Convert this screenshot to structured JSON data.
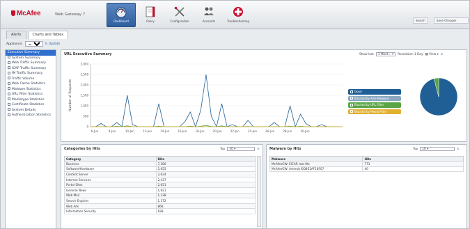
{
  "header": {
    "logo_text": "McAfee",
    "product_name": "Web Gateway 7",
    "nav": [
      {
        "label": "Dashboard",
        "icon": "dashboard-icon",
        "active": true
      },
      {
        "label": "Policy",
        "icon": "policy-icon",
        "active": false
      },
      {
        "label": "Configuration",
        "icon": "configuration-icon",
        "active": false
      },
      {
        "label": "Accounts",
        "icon": "accounts-icon",
        "active": false
      },
      {
        "label": "Troubleshooting",
        "icon": "troubleshooting-icon",
        "active": false
      }
    ],
    "search_label": "Search",
    "save_label": "Save Changes"
  },
  "tabs": [
    {
      "label": "Alerts",
      "active": false
    },
    {
      "label": "Charts and Tables",
      "active": true
    }
  ],
  "toolbar": {
    "appliance_label": "Appliance:",
    "appliance_value": "mwg7...",
    "update_label": "Update"
  },
  "sidebar": {
    "items": [
      {
        "label": "Executive Summary",
        "selected": true
      },
      {
        "label": "System Summary",
        "selected": false
      },
      {
        "label": "Web Traffic Summary",
        "selected": false
      },
      {
        "label": "ICAP Traffic Summary",
        "selected": false
      },
      {
        "label": "IM Traffic Summary",
        "selected": false
      },
      {
        "label": "Traffic Volume",
        "selected": false
      },
      {
        "label": "Web Cache Statistics",
        "selected": false
      },
      {
        "label": "Malware Statistics",
        "selected": false
      },
      {
        "label": "URL Filter Statistics",
        "selected": false
      },
      {
        "label": "Mediatype Statistics",
        "selected": false
      },
      {
        "label": "Certificate Statistics",
        "selected": false
      },
      {
        "label": "System Details",
        "selected": false
      },
      {
        "label": "Authentication Statistics",
        "selected": false
      }
    ]
  },
  "url_summary": {
    "title": "URL Executive Summary",
    "show_last_label": "Show last",
    "show_last_value": "1 Mont...",
    "resolution_label": "Resolution 1 Day",
    "view_label": "View"
  },
  "chart_data": {
    "type": "line",
    "ylabel": "Number of Requests",
    "ylim": [
      0,
      3000
    ],
    "yticks": [
      "3,000",
      "2,500",
      "2,000",
      "1,500",
      "1,000",
      "500",
      "0"
    ],
    "xticks": [
      "6-Jun",
      "8-Jun",
      "10-Jun",
      "12-Jun",
      "14-Jun",
      "16-Jun",
      "18-Jun",
      "20-Jun",
      "22-Jun",
      "24-Jun",
      "26-Jun",
      "28-Jun",
      "30-Jun"
    ],
    "x": [
      0,
      0.25,
      0.5,
      0.75,
      1,
      1.25,
      1.5,
      1.75,
      2,
      2.25,
      2.5,
      2.75,
      3,
      3.25,
      3.5,
      3.75,
      4,
      4.25,
      4.5,
      4.75,
      5,
      5.25,
      5.5,
      5.75,
      6,
      6.25,
      6.5,
      6.75,
      7,
      7.25,
      7.5,
      7.75,
      8,
      8.25,
      8.5,
      8.75,
      9,
      9.25,
      9.5,
      9.75,
      10,
      10.25,
      10.5,
      10.75,
      11,
      11.25,
      11.5,
      11.75,
      12
    ],
    "series": [
      {
        "name": "Good",
        "color": "#1f5f96",
        "values": [
          0,
          0,
          150,
          0,
          0,
          200,
          0,
          1500,
          100,
          0,
          0,
          0,
          0,
          1100,
          0,
          0,
          0,
          0,
          250,
          700,
          0,
          800,
          2500,
          500,
          0,
          1100,
          0,
          100,
          0,
          0,
          300,
          0,
          0,
          0,
          0,
          200,
          0,
          0,
          1000,
          0,
          600,
          150,
          0,
          0,
          100,
          0,
          0,
          0,
          0
        ]
      },
      {
        "name": "Blocked by Anti-Malware",
        "color": "#8aa8c0",
        "values": [
          0,
          0,
          0,
          0,
          0,
          0,
          0,
          0,
          0,
          0,
          0,
          0,
          0,
          0,
          0,
          0,
          0,
          0,
          0,
          0,
          0,
          0,
          0,
          0,
          0,
          0,
          0,
          0,
          0,
          0,
          0,
          0,
          0,
          0,
          0,
          0,
          0,
          0,
          0,
          0,
          0,
          0,
          0,
          0,
          0,
          0,
          0,
          0,
          0
        ]
      },
      {
        "name": "Blocked by URL Filter",
        "color": "#5aa545",
        "values": [
          0,
          0,
          0,
          0,
          0,
          20,
          0,
          40,
          0,
          0,
          0,
          0,
          0,
          30,
          0,
          0,
          0,
          0,
          0,
          30,
          0,
          20,
          60,
          10,
          0,
          40,
          0,
          0,
          0,
          0,
          10,
          0,
          0,
          0,
          0,
          0,
          0,
          0,
          30,
          0,
          20,
          0,
          0,
          0,
          0,
          0,
          0,
          0,
          0
        ]
      },
      {
        "name": "Blocked by Media Filter",
        "color": "#e0b030",
        "values": [
          0,
          0,
          0,
          0,
          0,
          0,
          0,
          0,
          0,
          0,
          0,
          0,
          0,
          0,
          0,
          0,
          0,
          0,
          0,
          0,
          0,
          0,
          0,
          0,
          0,
          0,
          0,
          0,
          0,
          0,
          0,
          0,
          0,
          0,
          0,
          0,
          0,
          0,
          0,
          0,
          0,
          0,
          0,
          0,
          0,
          0,
          0,
          0,
          0
        ]
      }
    ],
    "pie": [
      {
        "name": "Good",
        "value": 96,
        "color": "#1f5f96"
      },
      {
        "name": "Blocked by URL Filter",
        "value": 4,
        "color": "#5aa545"
      }
    ]
  },
  "categories_panel": {
    "title": "Categories by Hits",
    "top_label": "Top",
    "top_value": "10",
    "columns": [
      "Category",
      "Hits"
    ],
    "rows": [
      [
        "Business",
        "7,380"
      ],
      [
        "Software/Hardware",
        "5,655"
      ],
      [
        "Content Server",
        "2,624"
      ],
      [
        "Internet Services",
        "2,437"
      ],
      [
        "Portal Sites",
        "2,051"
      ],
      [
        "General News",
        "1,921"
      ],
      [
        "Web Mail",
        "1,338"
      ],
      [
        "Search Engines",
        "1,172"
      ],
      [
        "Web Ads",
        "868"
      ],
      [
        "Information Security",
        "838"
      ]
    ]
  },
  "malware_panel": {
    "title": "Malware by Hits",
    "top_label": "Top",
    "top_value": "10",
    "columns": [
      "Malware",
      "Hits"
    ],
    "rows": [
      [
        "McAfeeGW: EICAR test file",
        "771"
      ],
      [
        "McAfeeGW: Artemis!0D8E1AF18F07",
        "40"
      ]
    ]
  }
}
